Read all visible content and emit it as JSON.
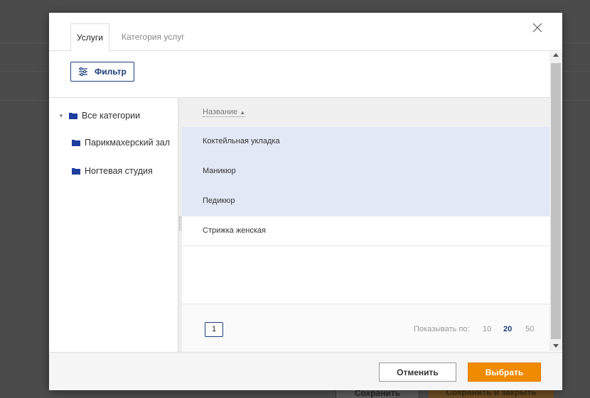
{
  "background": {
    "save_label": "Сохранить",
    "save_close_label": "Сохранить и закрыть"
  },
  "dialog": {
    "tabs": [
      {
        "label": "Услуги",
        "active": true
      },
      {
        "label": "Категория услуг",
        "active": false
      }
    ],
    "filter_label": "Фильтр",
    "tree": [
      {
        "label": "Все категории",
        "expanded": true,
        "level": 0
      },
      {
        "label": "Парикмахерский зал",
        "level": 1
      },
      {
        "label": "Ногтевая студия",
        "level": 1
      }
    ],
    "grid": {
      "column_name": "Название",
      "sort_indicator": "▲",
      "rows": [
        {
          "name": "Коктейльная укладка",
          "selected": true
        },
        {
          "name": "Маникюр",
          "selected": true
        },
        {
          "name": "Педикюр",
          "selected": true
        },
        {
          "name": "Стрижка женская",
          "selected": false
        }
      ]
    },
    "pager": {
      "current_page": "1",
      "per_page_label": "Показывать по:",
      "per_page_options": [
        "10",
        "20",
        "50"
      ],
      "per_page_selected": "20"
    },
    "footer": {
      "cancel_label": "Отменить",
      "select_label": "Выбрать"
    }
  },
  "colors": {
    "accent": "#1f3d7a",
    "primary_button": "#f08a00",
    "selected_row": "#e3e8f6"
  }
}
